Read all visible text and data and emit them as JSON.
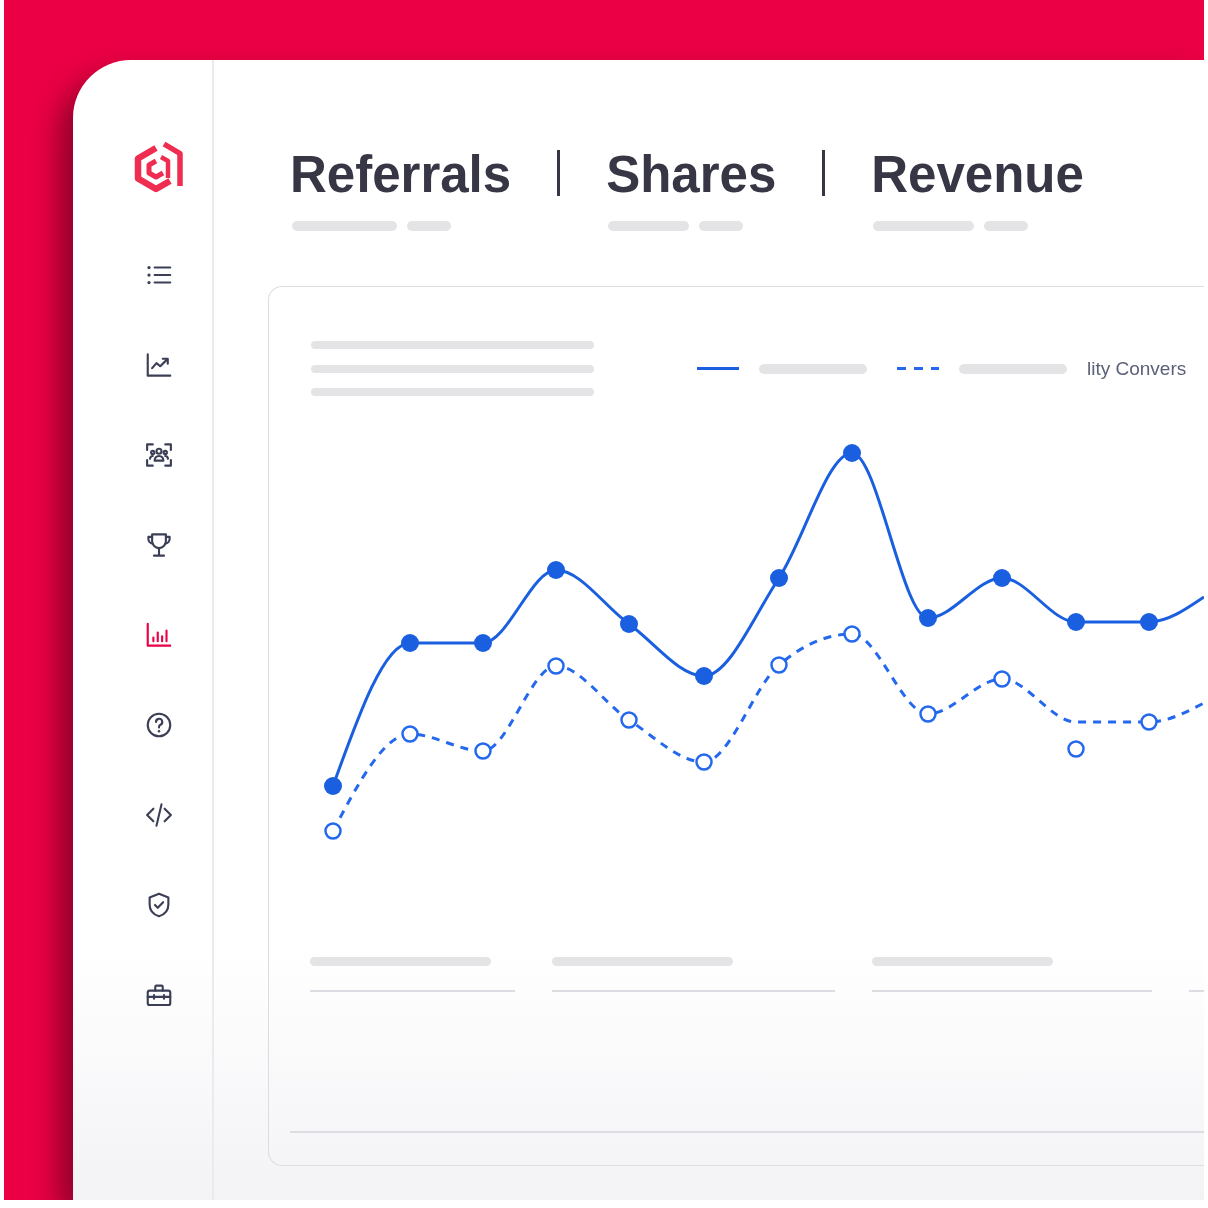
{
  "sidebar": {
    "items": [
      {
        "selected": false
      },
      {
        "selected": false
      },
      {
        "selected": false
      },
      {
        "selected": false
      },
      {
        "selected": true
      },
      {
        "selected": false
      },
      {
        "selected": false
      },
      {
        "selected": false
      },
      {
        "selected": false
      }
    ]
  },
  "metrics": [
    {
      "title": "Referrals"
    },
    {
      "title": "Shares"
    },
    {
      "title": "Revenue"
    }
  ],
  "chart": {
    "series": [
      {
        "kind": "solid"
      },
      {
        "kind": "dashed"
      }
    ],
    "legend_label": "lity Convers"
  }
}
